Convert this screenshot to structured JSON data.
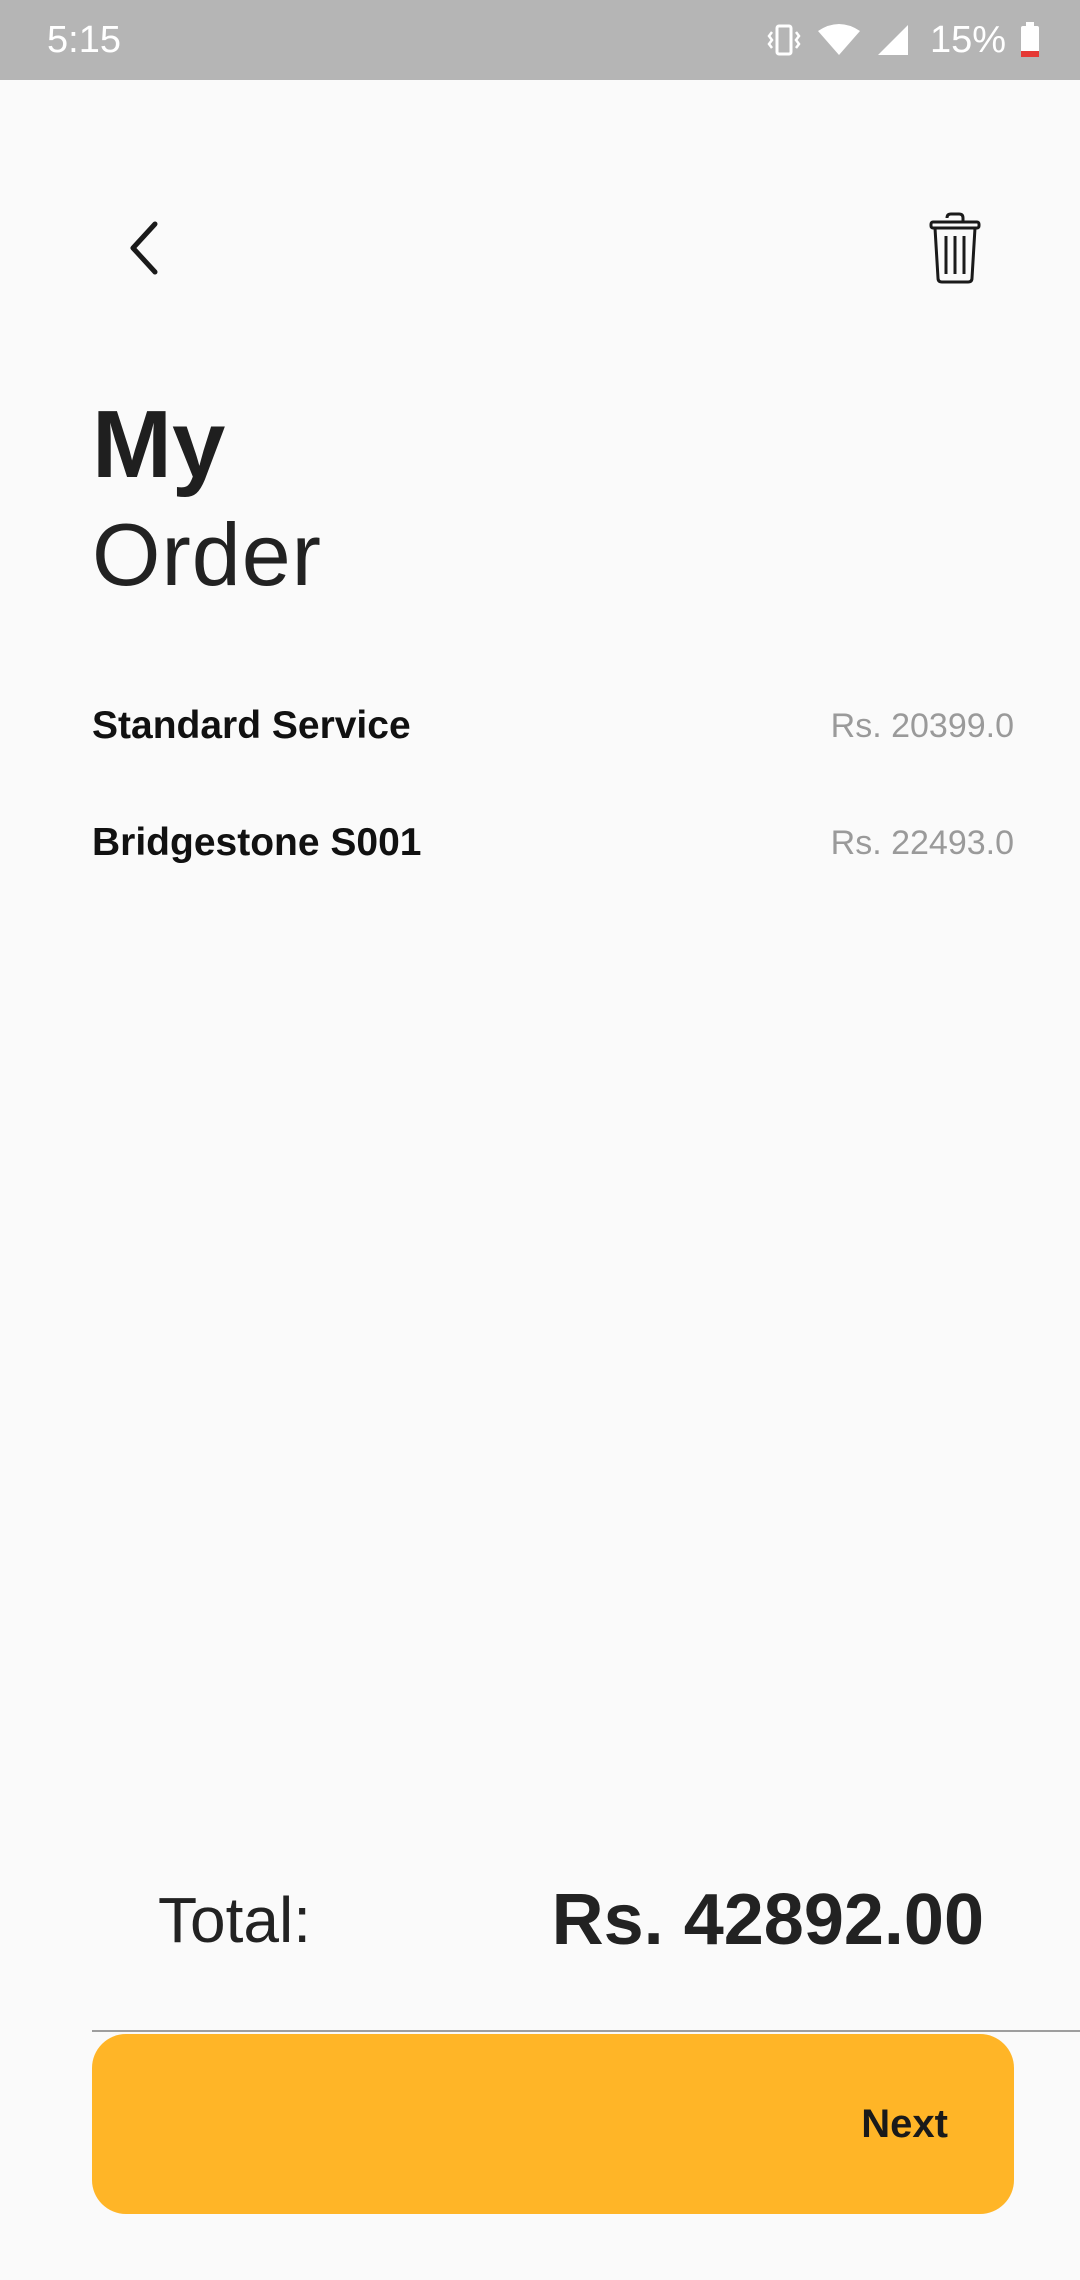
{
  "status_bar": {
    "time": "5:15",
    "battery_percent": "15%",
    "icons": [
      "vibrate-icon",
      "wifi-icon",
      "signal-icon",
      "battery-low-icon"
    ],
    "battery_accent": "#E53935"
  },
  "header": {
    "back_icon": "chevron-left-icon",
    "delete_icon": "trash-icon"
  },
  "title": {
    "line1": "My",
    "line2": "Order"
  },
  "order_items": [
    {
      "name": "Standard Service",
      "price": "Rs. 20399.0"
    },
    {
      "name": "Bridgestone S001",
      "price": "Rs. 22493.0"
    }
  ],
  "total": {
    "label": "Total:",
    "value": "Rs. 42892.00"
  },
  "next_button": {
    "label": "Next",
    "color": "#FFB527"
  }
}
